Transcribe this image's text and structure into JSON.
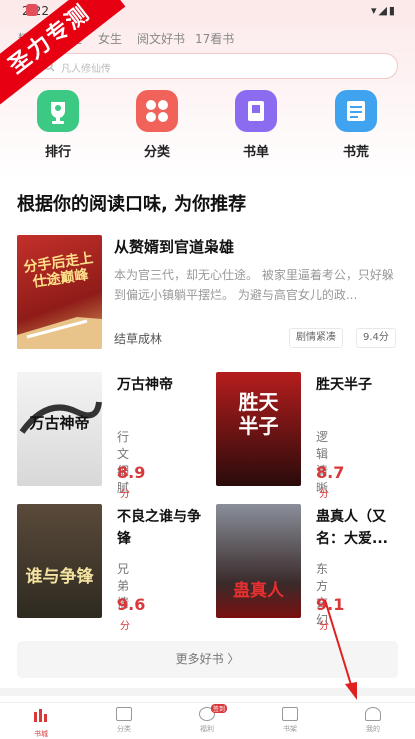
{
  "status_bar": {
    "time": "2:22",
    "icons": "▾◢▮"
  },
  "watermark": "圣力专测",
  "tabs": [
    {
      "label": "精选"
    },
    {
      "label": "男生"
    },
    {
      "label": "女生"
    },
    {
      "label": "阅文好书"
    },
    {
      "label": "17看书"
    }
  ],
  "search": {
    "placeholder": "凡人修仙传"
  },
  "quick_entries": [
    {
      "label": "排行",
      "icon": "trophy-icon",
      "color": "#3cc983"
    },
    {
      "label": "分类",
      "icon": "category-icon",
      "color": "#f0625a"
    },
    {
      "label": "书单",
      "icon": "booklist-icon",
      "color": "#8b6cf0"
    },
    {
      "label": "书荒",
      "icon": "book-shortage-icon",
      "color": "#3fa3ef"
    }
  ],
  "section_title": "根据你的阅读口味, 为你推荐",
  "featured": {
    "title": "从赘婿到官道枭雄",
    "description": "本为官三代，却无心仕途。 被家里逼着考公，只好躲到偏远小镇躺平摆烂。 为避与高官女儿的政...",
    "author": "结草成林",
    "tags": [
      "剧情紧凑",
      "9.4分"
    ],
    "cover_text": "分手后走上仕途巅峰"
  },
  "books": [
    {
      "title": "万古神帝",
      "category": "行文细腻",
      "score": "8.9",
      "unit": "分",
      "cover_text": "万古神帝"
    },
    {
      "title": "胜天半子",
      "category": "逻辑清晰",
      "score": "8.7",
      "unit": "分",
      "cover_text": "胜天半子"
    },
    {
      "title": "不良之谁与争锋",
      "category": "兄弟情",
      "score": "9.6",
      "unit": "分",
      "cover_text": "谁与争锋"
    },
    {
      "title": "蛊真人（又名：大爱...",
      "category": "东方玄幻",
      "score": "9.1",
      "unit": "分",
      "cover_text": "蛊真人"
    }
  ],
  "more_button": "更多好书 〉",
  "bottom_nav": [
    {
      "label": "书城",
      "icon": "bookstore-icon",
      "active": true
    },
    {
      "label": "分类",
      "icon": "grid-icon"
    },
    {
      "label": "福利",
      "icon": "welfare-icon",
      "badge": "签到"
    },
    {
      "label": "书架",
      "icon": "bookshelf-icon"
    },
    {
      "label": "我的",
      "icon": "profile-icon"
    }
  ],
  "colors": {
    "accent": "#d9383a",
    "header_bg": "#fce9ea"
  }
}
